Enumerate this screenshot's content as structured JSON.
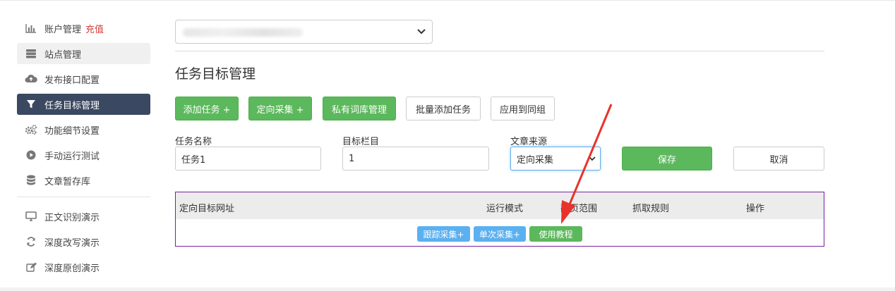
{
  "sidebar": {
    "items": [
      {
        "label": "账户管理",
        "extra": "充值",
        "icon": "bar-chart-icon"
      },
      {
        "label": "站点管理",
        "icon": "server-icon"
      },
      {
        "label": "发布接口配置",
        "icon": "cloud-upload-icon"
      },
      {
        "label": "任务目标管理",
        "icon": "filter-icon"
      },
      {
        "label": "功能细节设置",
        "icon": "gears-icon"
      },
      {
        "label": "手动运行测试",
        "icon": "play-circle-icon"
      },
      {
        "label": "文章暂存库",
        "icon": "database-icon"
      }
    ],
    "demo_items": [
      {
        "label": "正文识别演示",
        "icon": "monitor-icon"
      },
      {
        "label": "深度改写演示",
        "icon": "refresh-icon"
      },
      {
        "label": "深度原创演示",
        "icon": "edit-icon"
      }
    ]
  },
  "main": {
    "page_title": "任务目标管理",
    "toolbar": {
      "add_task": "添加任务 +",
      "directed_collect": "定向采集 +",
      "private_lexicon": "私有词库管理",
      "batch_add": "批量添加任务",
      "apply_group": "应用到同组"
    },
    "form": {
      "task_name_label": "任务名称",
      "task_name_value": "任务1",
      "target_column_label": "目标栏目",
      "target_column_value": "1",
      "source_label": "文章来源",
      "source_value": "定向采集",
      "save": "保存",
      "cancel": "取消"
    },
    "table": {
      "headers": [
        "定向目标网址",
        "运行模式",
        "翻页范围",
        "抓取规则",
        "操作"
      ],
      "track_collect": "跟踪采集+",
      "single_collect": "单次采集+",
      "tutorial": "使用教程"
    }
  },
  "colors": {
    "green": "#5cb85c",
    "blue": "#5bb0f0",
    "active_nav": "#3b4861",
    "accent_red": "#d43f3a",
    "table_border": "#7a1fa2",
    "arrow": "#e8332a"
  }
}
